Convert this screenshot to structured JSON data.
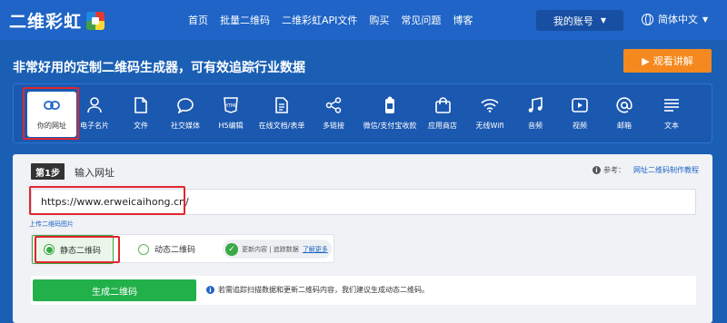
{
  "brand": {
    "name": "二维彩虹"
  },
  "nav": {
    "links": [
      "首页",
      "批量二维码",
      "二维彩虹API文件",
      "购买",
      "常见问题",
      "博客"
    ],
    "account_label": "我的账号",
    "language_label": "简体中文"
  },
  "hero": {
    "headline": "非常好用的定制二维码生成器，可有效追踪行业数据",
    "watch_label": "观看讲解"
  },
  "types": [
    {
      "label": "你的网址",
      "icon": "link-icon",
      "active": true
    },
    {
      "label": "电子名片",
      "icon": "person-icon"
    },
    {
      "label": "文件",
      "icon": "file-icon"
    },
    {
      "label": "社交媒体",
      "icon": "chat-bubble-icon"
    },
    {
      "label": "H5编辑",
      "icon": "html-icon"
    },
    {
      "label": "在线文档/表单",
      "icon": "document-icon"
    },
    {
      "label": "多链接",
      "icon": "share-icon"
    },
    {
      "label": "微信/支付宝收款",
      "icon": "payment-icon"
    },
    {
      "label": "应用商店",
      "icon": "shopping-bag-icon"
    },
    {
      "label": "无线Wifi",
      "icon": "wifi-icon"
    },
    {
      "label": "音频",
      "icon": "music-note-icon"
    },
    {
      "label": "视频",
      "icon": "video-play-icon"
    },
    {
      "label": "邮箱",
      "icon": "at-sign-icon"
    },
    {
      "label": "文本",
      "icon": "text-lines-icon"
    }
  ],
  "step": {
    "badge": "第1步",
    "title": "输入网址",
    "ref_prefix": "参考：",
    "ref_link": "网址二维码制作教程"
  },
  "url_input": {
    "value": "https://www.erweicaihong.cn/"
  },
  "upload_link": "上传二维码图片",
  "mode": {
    "static_label": "静态二维码",
    "dynamic_label": "动态二维码",
    "feature_text": "更新内容 | 追踪数据",
    "more_link": "了解更多"
  },
  "generate": {
    "button_label": "生成二维码",
    "hint": "若需追踪扫描数据和更新二维码内容，我们建议生成动态二维码。"
  },
  "colors": {
    "nav_bg": "#1f64c6",
    "page_bg": "#1a5fb4",
    "accent_orange": "#f5891f",
    "accent_green": "#22b04b",
    "highlight_red": "#e0262d"
  }
}
